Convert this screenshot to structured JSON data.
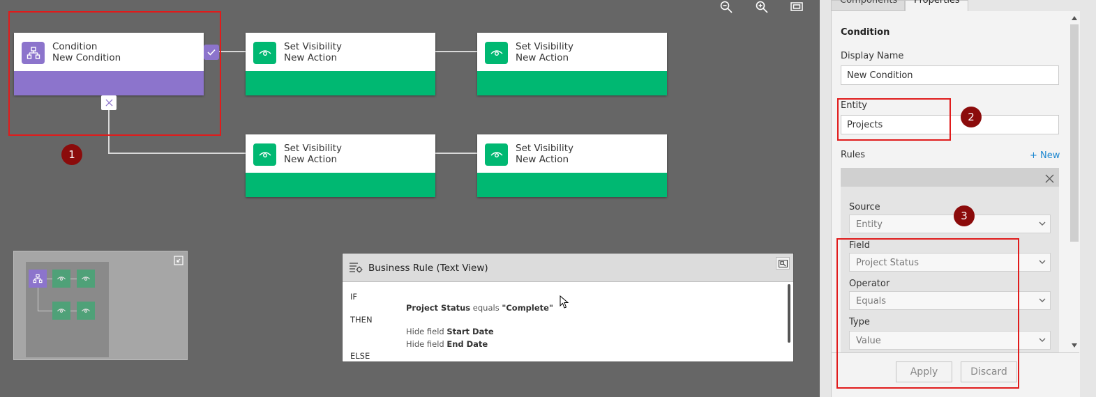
{
  "toolbar": {
    "zoom_out_icon": "zoom-out-icon",
    "zoom_in_icon": "zoom-in-icon",
    "fit_icon": "fit-screen-icon"
  },
  "nodes": {
    "condition": {
      "title": "Condition",
      "name": "New Condition"
    },
    "action_top_1": {
      "title": "Set Visibility",
      "name": "New Action"
    },
    "action_top_2": {
      "title": "Set Visibility",
      "name": "New Action"
    },
    "action_bottom_1": {
      "title": "Set Visibility",
      "name": "New Action"
    },
    "action_bottom_2": {
      "title": "Set Visibility",
      "name": "New Action"
    }
  },
  "badges": {
    "b1": "1",
    "b2": "2",
    "b3": "3"
  },
  "text_view": {
    "title": "Business Rule (Text View)",
    "if": "IF",
    "cond_field": "Project Status",
    "cond_op": " equals ",
    "cond_value": "\"Complete\"",
    "then": "THEN",
    "hide1_prefix": "Hide field ",
    "hide1_field": "Start Date",
    "hide2_prefix": "Hide field ",
    "hide2_field": "End Date",
    "else": "ELSE"
  },
  "panel": {
    "tabs": [
      "Components",
      "Properties"
    ],
    "section_title": "Condition",
    "display_name_label": "Display Name",
    "display_name_value": "New Condition",
    "entity_label": "Entity",
    "entity_value": "Projects",
    "rules_label": "Rules",
    "new_link": "+ New",
    "source_label": "Source",
    "source_value": "Entity",
    "field_label": "Field",
    "field_value": "Project Status",
    "operator_label": "Operator",
    "operator_value": "Equals",
    "type_label": "Type",
    "type_value": "Value",
    "apply_button": "Apply",
    "discard_button": "Discard"
  },
  "colors": {
    "canvas": "#666666",
    "condition": "#8c74cc",
    "action": "#00b872",
    "annotation": "#e01b1b",
    "badge": "#8b0b0b",
    "link": "#1a86d0"
  }
}
